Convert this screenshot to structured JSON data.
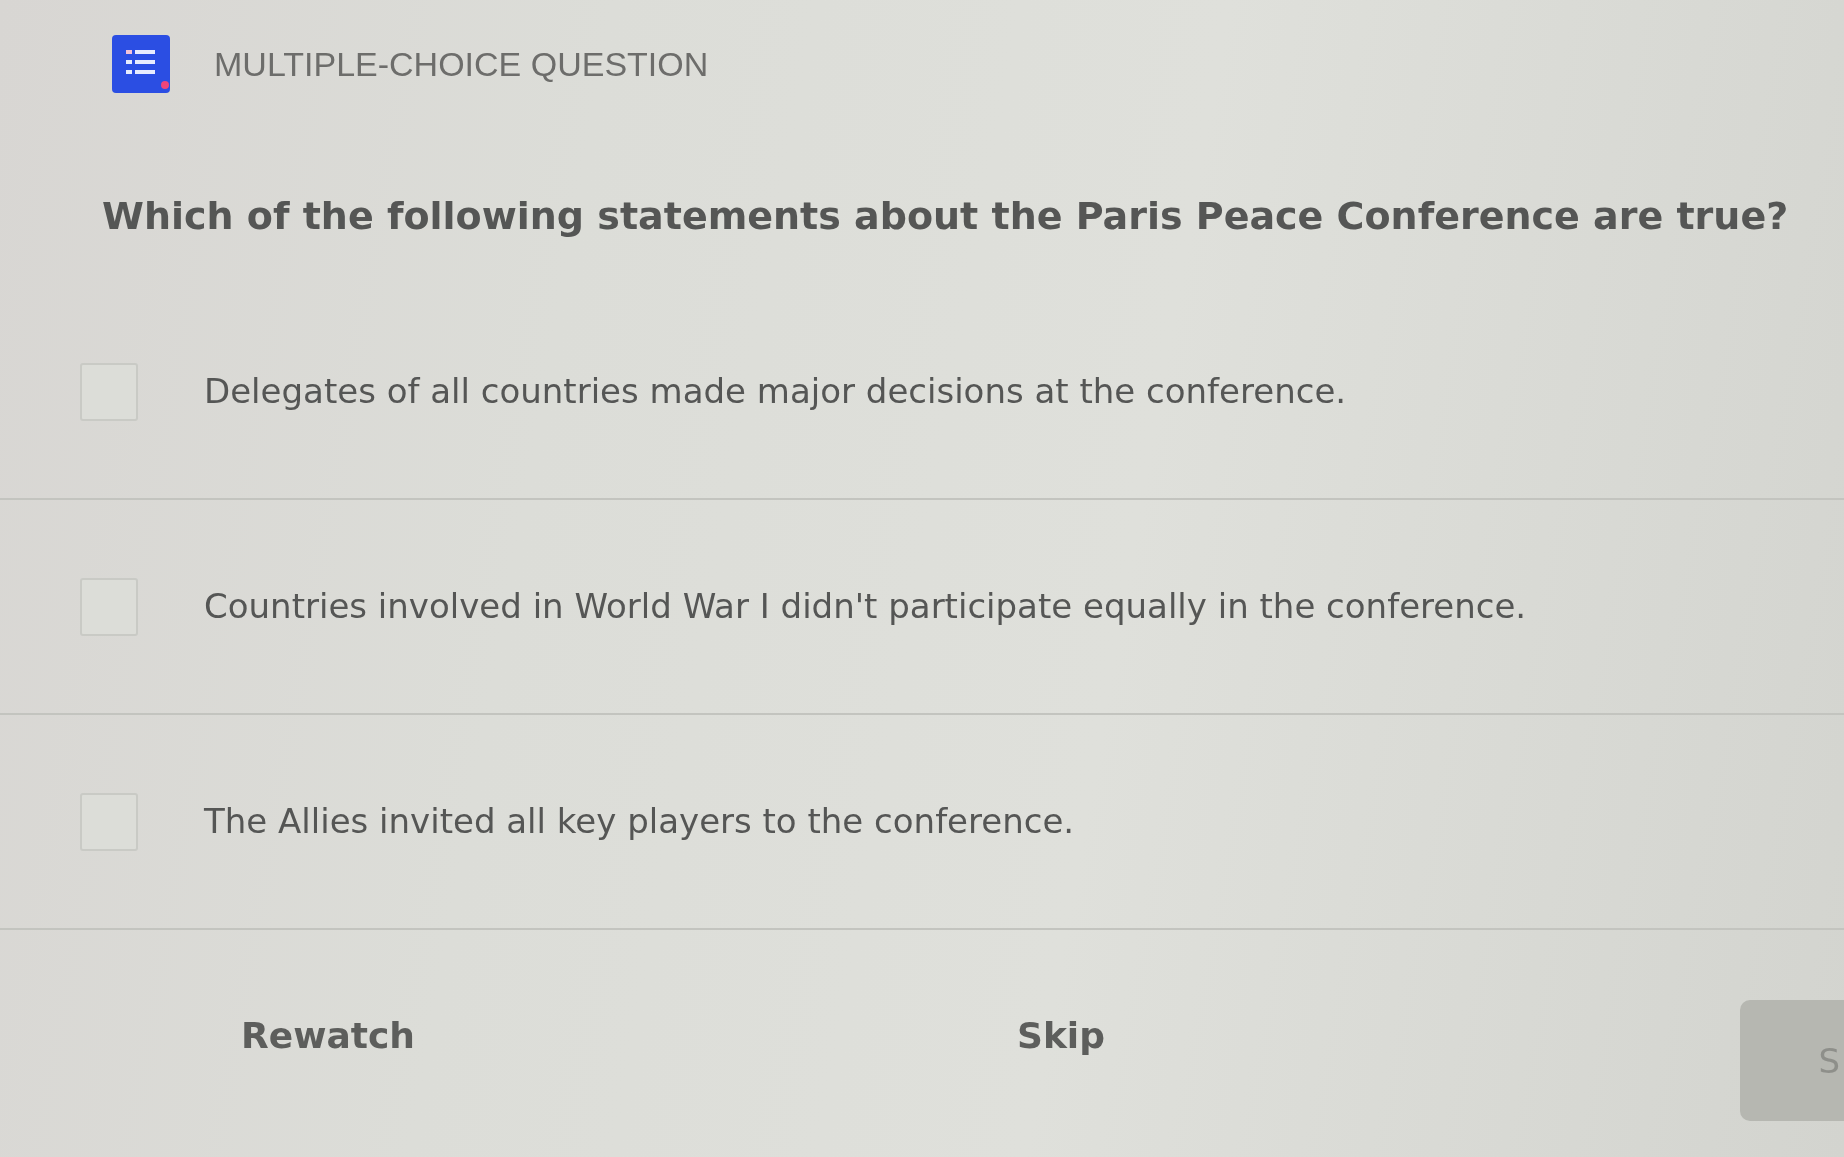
{
  "header": {
    "title": "MULTIPLE-CHOICE QUESTION"
  },
  "question": "Which of the following statements about the Paris Peace Conference are true?",
  "options": [
    {
      "text": "Delegates of all countries made major decisions at the conference.",
      "checked": false
    },
    {
      "text": "Countries involved in World War I didn't participate equally in the conference.",
      "checked": false
    },
    {
      "text": "The Allies invited all key players to the conference.",
      "checked": false
    }
  ],
  "actions": [
    {
      "kind": "link",
      "label": "Rewatch"
    },
    {
      "kind": "link",
      "label": "Skip"
    },
    {
      "kind": "button",
      "label": "S"
    }
  ]
}
